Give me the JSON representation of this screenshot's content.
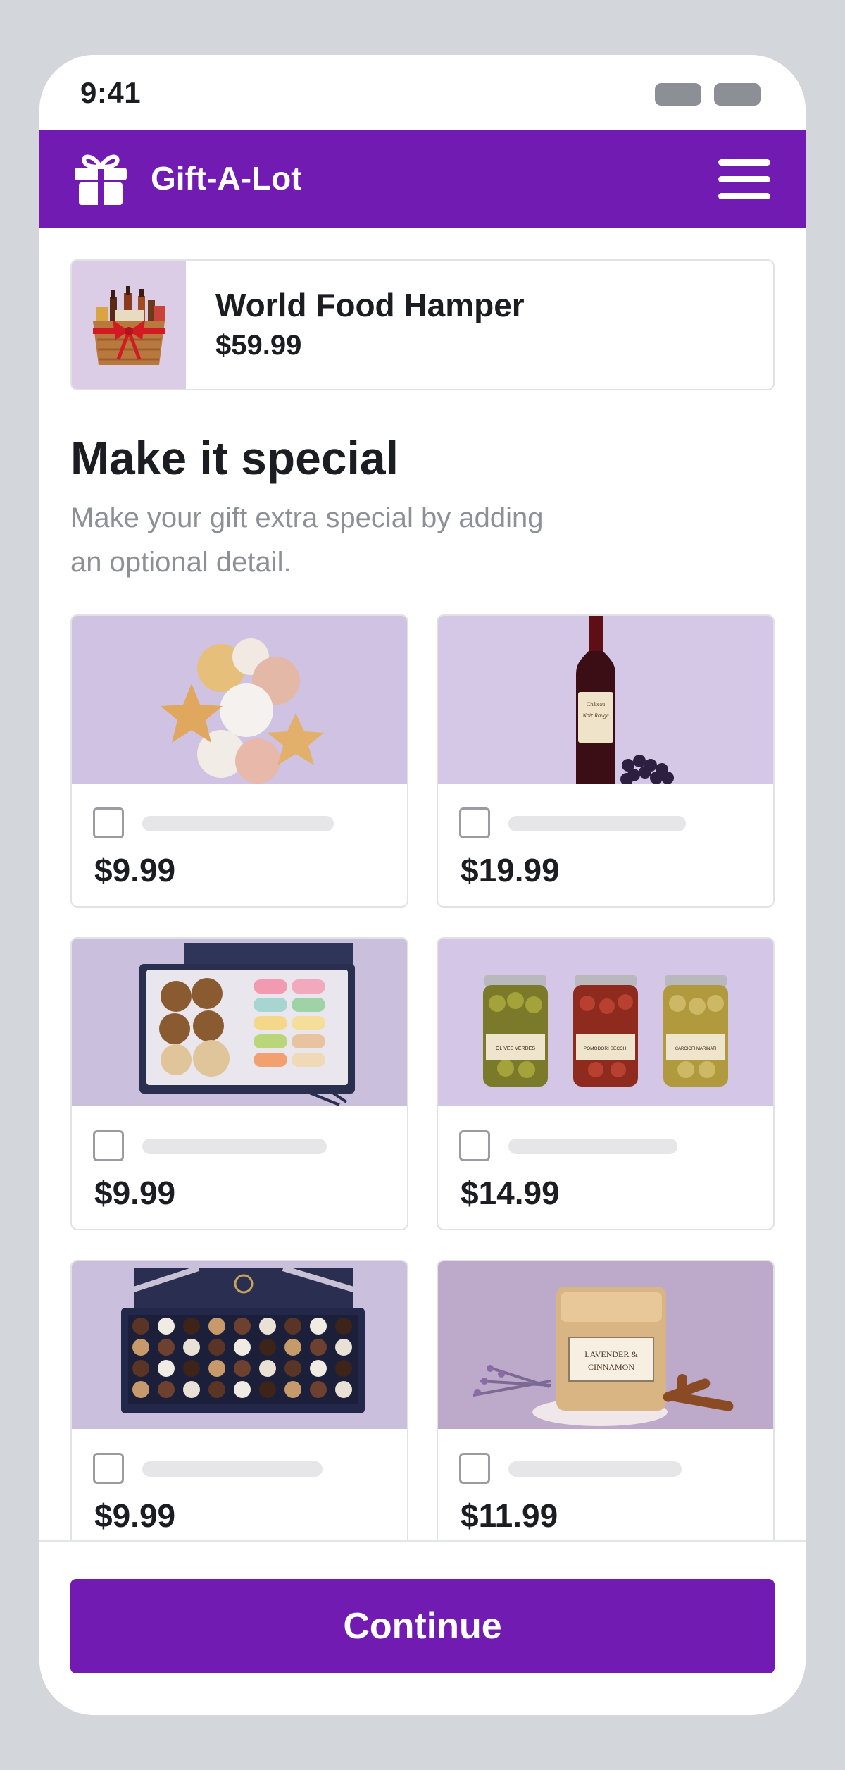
{
  "status_bar": {
    "time": "9:41"
  },
  "header": {
    "brand_name": "Gift-A-Lot",
    "brand_icon": "gift-icon",
    "menu_icon": "hamburger-menu-icon"
  },
  "selected_product": {
    "name": "World Food Hamper",
    "price": "$59.99",
    "image": "gift-hamper-photo"
  },
  "section": {
    "title": "Make it special",
    "subtitle_line_1": "Make your gift extra special by adding",
    "subtitle_line_2": "an optional detail."
  },
  "addons": [
    {
      "price": "$9.99",
      "image": "balloons-photo",
      "checked": false
    },
    {
      "price": "$19.99",
      "image": "wine-bottle-photo",
      "checked": false
    },
    {
      "price": "$9.99",
      "image": "cookies-macarons-box-photo",
      "checked": false
    },
    {
      "price": "$14.99",
      "image": "jars-photo",
      "checked": false
    },
    {
      "price": "$9.99",
      "image": "chocolates-box-photo",
      "checked": false
    },
    {
      "price": "$11.99",
      "image": "candle-photo",
      "checked": false
    }
  ],
  "jar_labels": [
    "OLIVES VERDES",
    "POMODORI SECCHI",
    "CARCIOFI MARINATI"
  ],
  "wine_label": {
    "line_1": "Château",
    "line_2": "Noir Rouge"
  },
  "candle_label": {
    "line_1": "LAVENDER &",
    "line_2": "CINNAMON"
  },
  "footer": {
    "continue_label": "Continue"
  },
  "colors": {
    "brand_purple": "#721bb3",
    "card_bg": "#d5c8e6",
    "text_dark": "#1c1d22",
    "text_muted": "#8e9097"
  }
}
